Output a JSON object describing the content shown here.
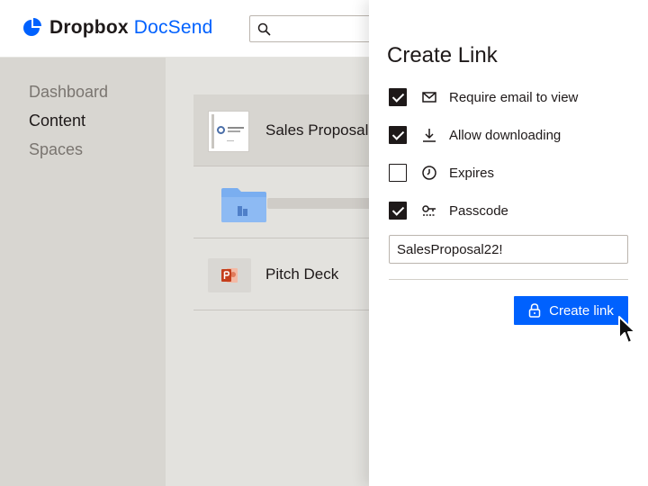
{
  "header": {
    "brand": "Dropbox",
    "product": "DocSend",
    "brand_color": "#0061fe",
    "logo_icon": "dropbox-docsend-logo-icon",
    "search_icon": "search-icon"
  },
  "sidebar": {
    "items": [
      {
        "label": "Dashboard",
        "active": false
      },
      {
        "label": "Content",
        "active": true
      },
      {
        "label": "Spaces",
        "active": false
      }
    ]
  },
  "content": {
    "rows": [
      {
        "title": "Sales Proposal",
        "thumbnail": "document",
        "selected": true
      },
      {
        "title": "",
        "thumbnail": "folder-icon",
        "selected": false
      },
      {
        "title": "Pitch Deck",
        "thumbnail": "powerpoint-icon",
        "selected": false
      }
    ]
  },
  "panel": {
    "title": "Create Link",
    "options": [
      {
        "label": "Require email to view",
        "checked": true,
        "icon": "mail-icon"
      },
      {
        "label": "Allow downloading",
        "checked": true,
        "icon": "download-icon"
      },
      {
        "label": "Expires",
        "checked": false,
        "icon": "clock-icon"
      },
      {
        "label": "Passcode",
        "checked": true,
        "icon": "key-icon"
      }
    ],
    "passcode_value": "SalesProposal22!",
    "create_button_label": "Create link",
    "create_button_icon": "lock-icon"
  }
}
